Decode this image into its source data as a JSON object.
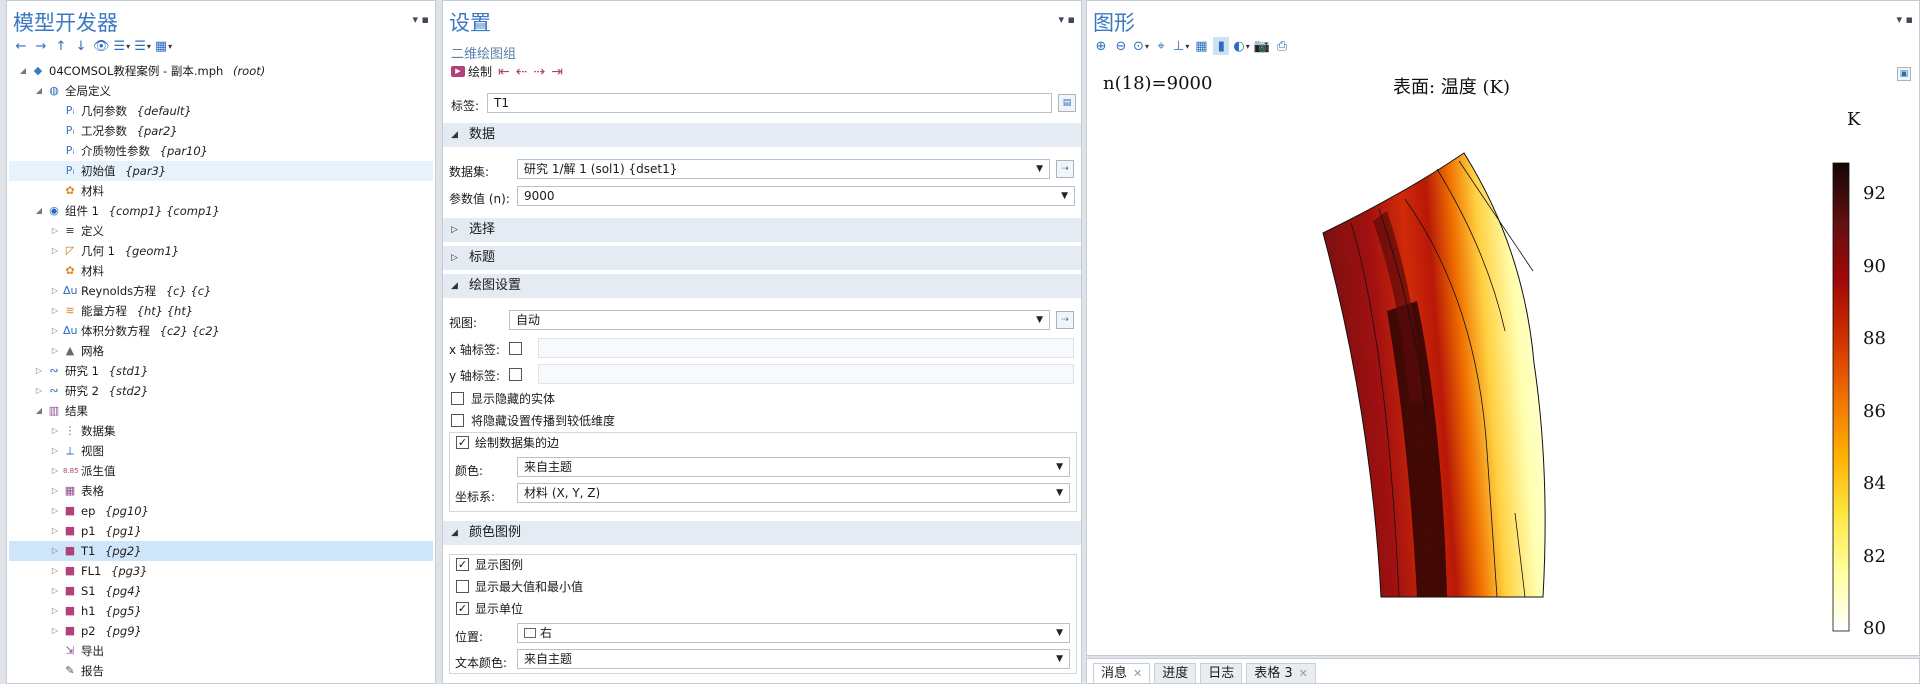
{
  "left": {
    "title": "模型开发器",
    "tree": [
      {
        "label": "04COMSOL教程案例 - 副本.mph",
        "tag": "(root)",
        "icon": "model-icon",
        "lvl": 0,
        "open": true
      },
      {
        "label": "全局定义",
        "tag": "",
        "icon": "globe-icon",
        "lvl": 1,
        "open": true
      },
      {
        "label": "几何参数",
        "tag": "{default}",
        "icon": "parameters-icon",
        "lvl": 2
      },
      {
        "label": "工况参数",
        "tag": "{par2}",
        "icon": "parameters-icon",
        "lvl": 2
      },
      {
        "label": "介质物性参数",
        "tag": "{par10}",
        "icon": "parameters-icon",
        "lvl": 2
      },
      {
        "label": "初始值",
        "tag": "{par3}",
        "icon": "parameters-icon",
        "lvl": 2,
        "state": "sel2"
      },
      {
        "label": "材料",
        "tag": "",
        "icon": "materials-icon",
        "lvl": 2
      },
      {
        "label": "组件 1",
        "tag": "{comp1} {comp1}",
        "icon": "component-icon",
        "lvl": 1,
        "open": true
      },
      {
        "label": "定义",
        "tag": "",
        "icon": "definitions-icon",
        "lvl": 2,
        "closed": true
      },
      {
        "label": "几何 1",
        "tag": "{geom1}",
        "icon": "geometry-icon",
        "lvl": 2,
        "closed": true
      },
      {
        "label": "材料",
        "tag": "",
        "icon": "materials-icon",
        "lvl": 2
      },
      {
        "label": "Reynolds方程",
        "tag": "{c} {c}",
        "icon": "physics-icon",
        "lvl": 2,
        "closed": true
      },
      {
        "label": "能量方程",
        "tag": "{ht} {ht}",
        "icon": "heat-icon",
        "lvl": 2,
        "closed": true
      },
      {
        "label": "体积分数方程",
        "tag": "{c2} {c2}",
        "icon": "physics-icon",
        "lvl": 2,
        "closed": true
      },
      {
        "label": "网格",
        "tag": "",
        "icon": "mesh-icon",
        "lvl": 2,
        "closed": true
      },
      {
        "label": "研究 1",
        "tag": "{std1}",
        "icon": "study-icon",
        "lvl": 1,
        "closed": true
      },
      {
        "label": "研究 2",
        "tag": "{std2}",
        "icon": "study-icon",
        "lvl": 1,
        "closed": true
      },
      {
        "label": "结果",
        "tag": "",
        "icon": "results-icon",
        "lvl": 1,
        "open": true
      },
      {
        "label": "数据集",
        "tag": "",
        "icon": "datasets-icon",
        "lvl": 2,
        "closed": true
      },
      {
        "label": "视图",
        "tag": "",
        "icon": "views-icon",
        "lvl": 2,
        "closed": true
      },
      {
        "label": "派生值",
        "tag": "",
        "icon": "derived-values-icon",
        "lvl": 2,
        "closed": true
      },
      {
        "label": "表格",
        "tag": "",
        "icon": "tables-icon",
        "lvl": 2,
        "closed": true
      },
      {
        "label": "ep",
        "tag": "{pg10}",
        "icon": "plot-group-icon",
        "lvl": 2,
        "closed": true
      },
      {
        "label": "p1",
        "tag": "{pg1}",
        "icon": "plot-group-icon",
        "lvl": 2,
        "closed": true
      },
      {
        "label": "T1",
        "tag": "{pg2}",
        "icon": "plot-group-icon",
        "lvl": 2,
        "closed": true,
        "state": "sel"
      },
      {
        "label": "FL1",
        "tag": "{pg3}",
        "icon": "plot-group-icon",
        "lvl": 2,
        "closed": true
      },
      {
        "label": "S1",
        "tag": "{pg4}",
        "icon": "plot-group-icon",
        "lvl": 2,
        "closed": true
      },
      {
        "label": "h1",
        "tag": "{pg5}",
        "icon": "plot-group-icon",
        "lvl": 2,
        "closed": true
      },
      {
        "label": "p2",
        "tag": "{pg9}",
        "icon": "plot-group-icon",
        "lvl": 2,
        "closed": true
      },
      {
        "label": "导出",
        "tag": "",
        "icon": "export-icon",
        "lvl": 2
      },
      {
        "label": "报告",
        "tag": "",
        "icon": "reports-icon",
        "lvl": 2
      }
    ]
  },
  "settings": {
    "title": "设置",
    "subtitle": "二维绘图组",
    "plot_label": "绘制",
    "label_label": "标签:",
    "label_value": "T1",
    "sec_data": "数据",
    "dataset_label": "数据集:",
    "dataset_value": "研究 1/解 1 (sol1) {dset1}",
    "param_label": "参数值 (n):",
    "param_value": "9000",
    "sec_selection": "选择",
    "sec_title": "标题",
    "sec_plot_settings": "绘图设置",
    "view_label": "视图:",
    "view_value": "自动",
    "xaxis_label": "x 轴标签:",
    "yaxis_label": "y 轴标签:",
    "show_hidden": "显示隐藏的实体",
    "propagate_hidden": "将隐藏设置传播到较低维度",
    "plot_edges": "绘制数据集的边",
    "color_label": "颜色:",
    "color_value": "来自主题",
    "frame_label": "坐标系:",
    "frame_value": "材料  (X, Y, Z)",
    "sec_legend": "颜色图例",
    "show_legend": "显示图例",
    "show_maxmin": "显示最大值和最小值",
    "show_units": "显示单位",
    "position_label": "位置:",
    "position_value": "右",
    "textcolor_label": "文本颜色:",
    "textcolor_value": "来自主题"
  },
  "graphics": {
    "title": "图形",
    "param_text": "n(18)=9000",
    "surface_title": "表面: 温度 (K)",
    "unit": "K",
    "ticks": [
      "92",
      "90",
      "88",
      "86",
      "84",
      "82",
      "80"
    ],
    "colormap": [
      "#ffffff",
      "#ffffa0",
      "#ffe640",
      "#ffb000",
      "#f07000",
      "#d03000",
      "#a00808",
      "#601010",
      "#140606"
    ]
  },
  "bottom_tabs": [
    "消息",
    "进度",
    "日志",
    "表格 3"
  ]
}
